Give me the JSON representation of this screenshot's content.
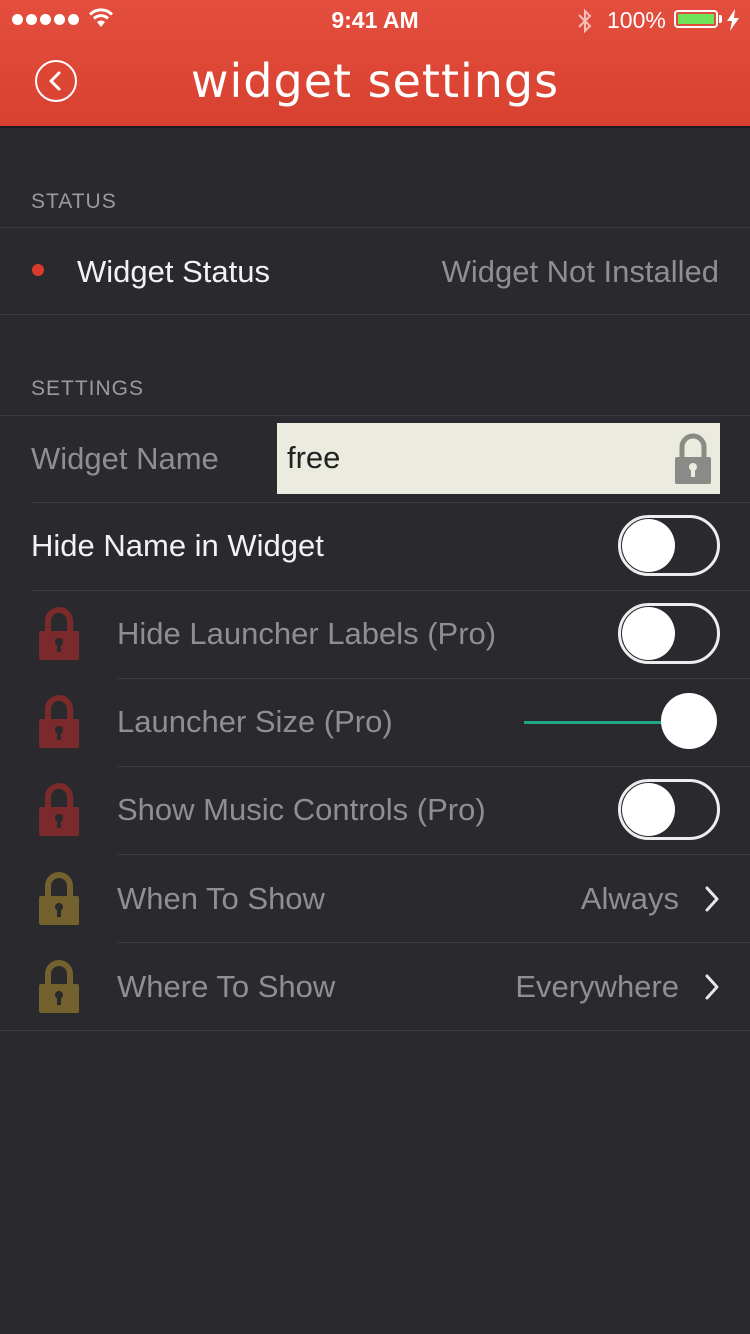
{
  "status_bar": {
    "time": "9:41 AM",
    "battery": "100%"
  },
  "header": {
    "title": "widget settings",
    "back_icon": "chevron-left-circle-icon"
  },
  "status_section": {
    "label": "STATUS",
    "widget_status_label": "Widget Status",
    "widget_status_value": "Widget Not Installed",
    "status_color": "#d93a2c"
  },
  "settings_section": {
    "label": "SETTINGS",
    "widget_name_label": "Widget Name",
    "widget_name_value": "free",
    "hide_name_label": "Hide Name in Widget",
    "hide_name_on": false,
    "hide_launcher_labels_label": "Hide Launcher Labels (Pro)",
    "hide_launcher_labels_on": false,
    "launcher_size_label": "Launcher Size (Pro)",
    "launcher_size_level": 1.0,
    "show_music_controls_label": "Show Music Controls (Pro)",
    "show_music_controls_on": false,
    "when_to_show_label": "When To Show",
    "when_to_show_value": "Always",
    "where_to_show_label": "Where To Show",
    "where_to_show_value": "Everywhere"
  },
  "colors": {
    "header_red": "#e0493a",
    "background": "#29292e",
    "locked_red": "#7a2a2a",
    "locked_gold": "#73612e",
    "slider_accent": "#1ea88a"
  }
}
